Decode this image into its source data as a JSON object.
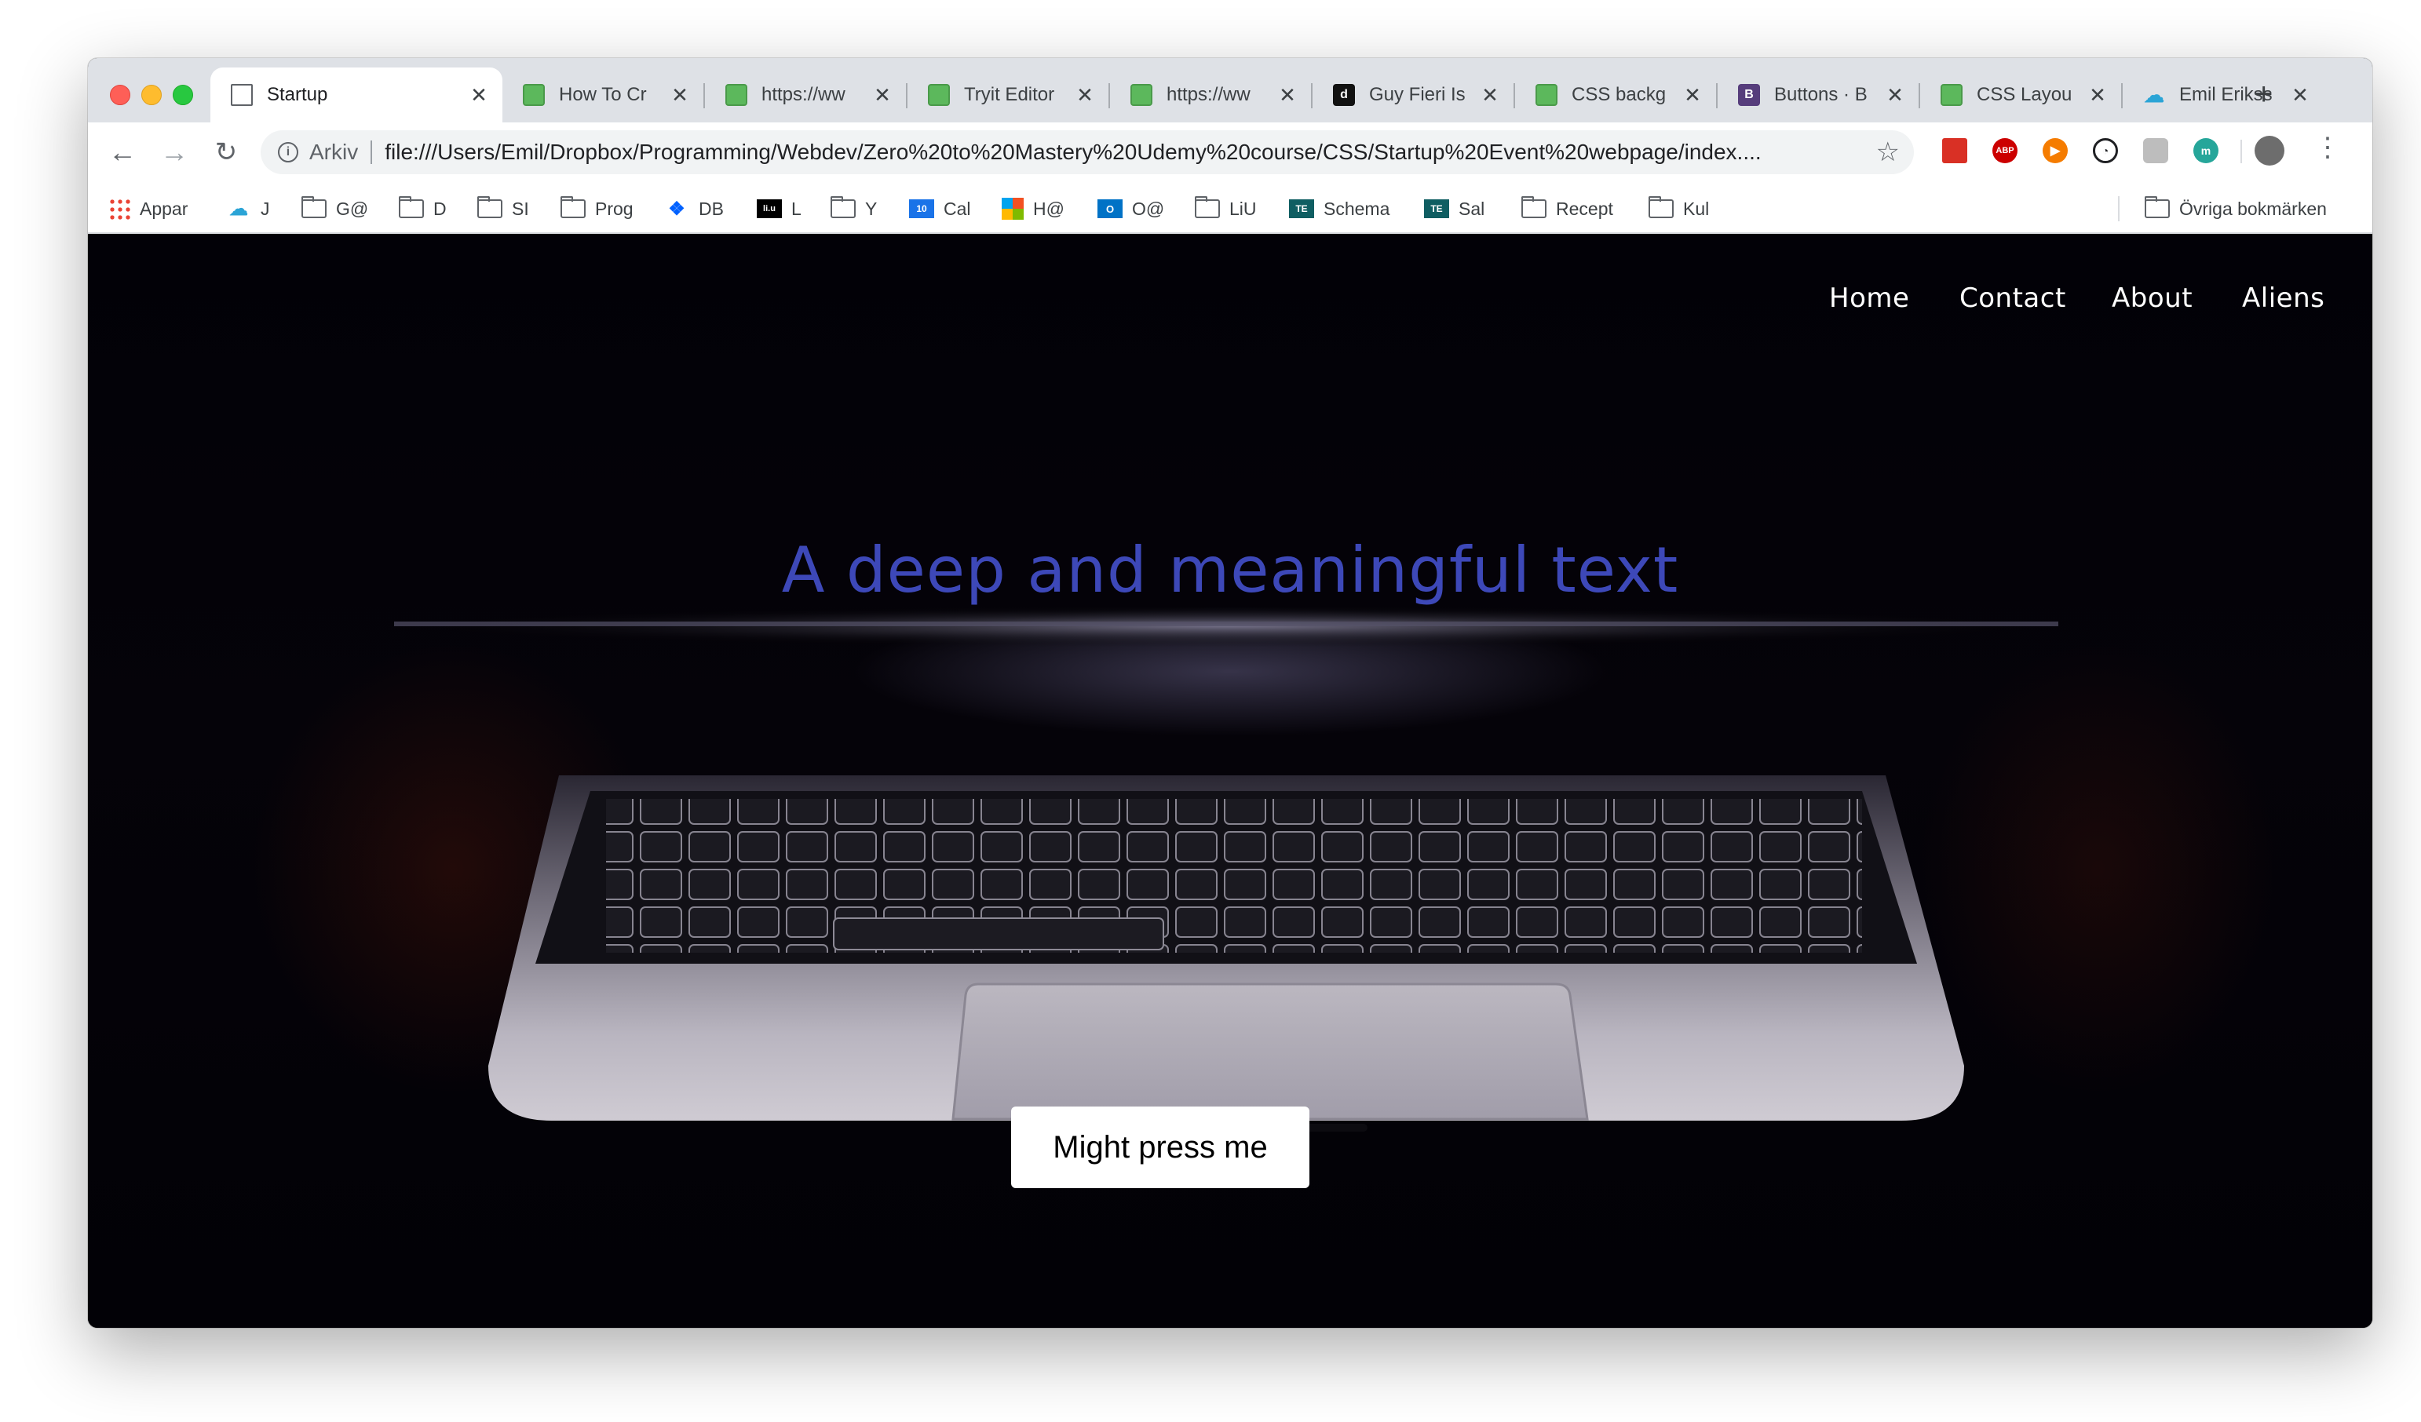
{
  "browser": {
    "tabs": [
      {
        "title": "Startup",
        "icon": "doc",
        "active": true
      },
      {
        "title": "How To Cr",
        "icon": "w3"
      },
      {
        "title": "https://ww",
        "icon": "w3"
      },
      {
        "title": "Tryit Editor",
        "icon": "w3"
      },
      {
        "title": "https://ww",
        "icon": "w3"
      },
      {
        "title": "Guy Fieri Is",
        "icon": "d"
      },
      {
        "title": "CSS backg",
        "icon": "w3"
      },
      {
        "title": "Buttons · B",
        "icon": "b"
      },
      {
        "title": "CSS Layou",
        "icon": "w3"
      },
      {
        "title": "Emil Erikss",
        "icon": "cloud"
      }
    ],
    "tab_close_glyph": "✕",
    "new_tab_glyph": "+",
    "address": {
      "chip": "Arkiv",
      "url": "file:///Users/Emil/Dropbox/Programming/Webdev/Zero%20to%20Mastery%20Udemy%20course/CSS/Startup%20Event%20webpage/index...."
    },
    "bookmarks": [
      {
        "label": "Appar",
        "icon": "apps-grid-icon"
      },
      {
        "label": "J",
        "icon": "cloud-icon"
      },
      {
        "label": "G@",
        "icon": "folder-icon"
      },
      {
        "label": "D",
        "icon": "folder-icon"
      },
      {
        "label": "SI",
        "icon": "folder-icon"
      },
      {
        "label": "Prog",
        "icon": "folder-icon"
      },
      {
        "label": "DB",
        "icon": "dropbox-icon"
      },
      {
        "label": "L",
        "icon": "liu-icon"
      },
      {
        "label": "Y",
        "icon": "folder-icon"
      },
      {
        "label": "Cal",
        "icon": "calendar-icon"
      },
      {
        "label": "H@",
        "icon": "microsoft-icon"
      },
      {
        "label": "O@",
        "icon": "outlook-icon"
      },
      {
        "label": "LiU",
        "icon": "folder-icon"
      },
      {
        "label": "Schema",
        "icon": "te-icon"
      },
      {
        "label": "Sal",
        "icon": "te-icon"
      },
      {
        "label": "Recept",
        "icon": "folder-icon"
      },
      {
        "label": "Kul",
        "icon": "folder-icon"
      }
    ],
    "other_bookmarks": "Övriga bokmärken"
  },
  "page": {
    "nav": [
      "Home",
      "Contact",
      "About",
      "Aliens"
    ],
    "hero_title": "A deep and meaningful text",
    "cta_label": "Might press me",
    "colors": {
      "hero_title": "#3d48b8",
      "background": "#030207",
      "cta_bg": "#ffffff"
    }
  }
}
